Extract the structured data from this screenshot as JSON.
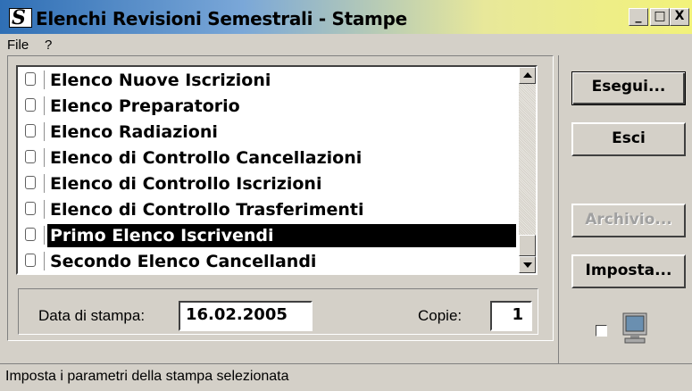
{
  "window": {
    "title": "Elenchi Revisioni Semestrali - Stampe",
    "icon": "app-s-icon"
  },
  "titlebar_buttons": {
    "minimize": "_",
    "maximize": "□",
    "close": "X"
  },
  "menu": {
    "items": [
      "File",
      "?"
    ]
  },
  "list": {
    "items": [
      {
        "label": "Elenco Nuove Iscrizioni",
        "checked": false,
        "selected": false
      },
      {
        "label": "Elenco Preparatorio",
        "checked": false,
        "selected": false
      },
      {
        "label": "Elenco Radiazioni",
        "checked": false,
        "selected": false
      },
      {
        "label": "Elenco di Controllo Cancellazioni",
        "checked": false,
        "selected": false
      },
      {
        "label": "Elenco di Controllo Iscrizioni",
        "checked": false,
        "selected": false
      },
      {
        "label": "Elenco di Controllo Trasferimenti",
        "checked": false,
        "selected": false
      },
      {
        "label": "Primo Elenco Iscrivendi",
        "checked": false,
        "selected": true
      },
      {
        "label": "Secondo Elenco Cancellandi",
        "checked": false,
        "selected": false
      }
    ]
  },
  "print": {
    "date_label": "Data di stampa:",
    "date_value": "16.02.2005",
    "copies_label": "Copie:",
    "copies_value": "1"
  },
  "buttons": {
    "esegui": "Esegui...",
    "esci": "Esci",
    "archivio": "Archivio...",
    "imposta": "Imposta..."
  },
  "status": {
    "text": "Imposta i parametri della stampa selezionata"
  }
}
